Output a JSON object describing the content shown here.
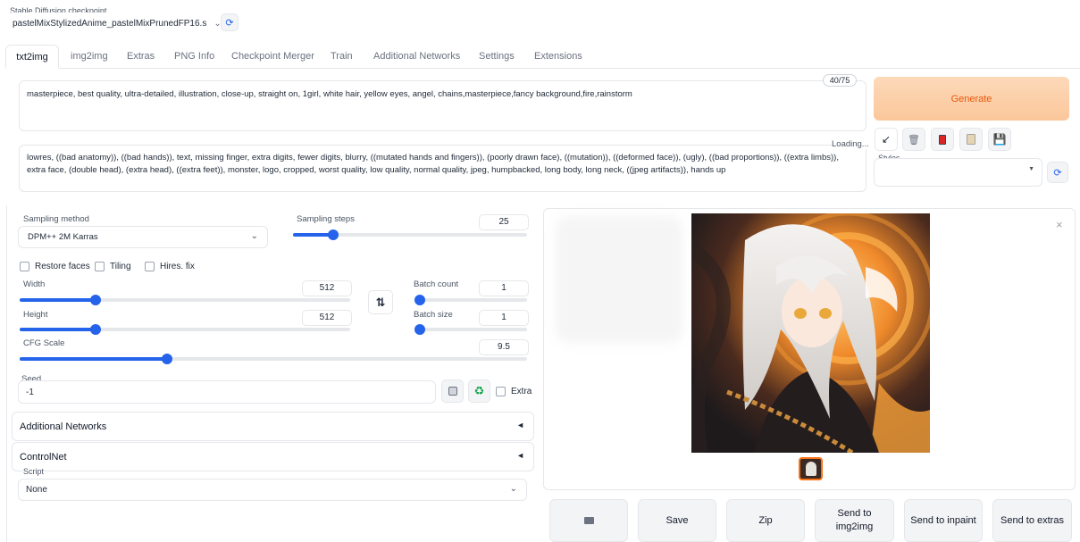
{
  "checkpoint": {
    "label": "Stable Diffusion checkpoint",
    "value": "pastelMixStylizedAnime_pastelMixPrunedFP16.s"
  },
  "tabs": [
    "txt2img",
    "img2img",
    "Extras",
    "PNG Info",
    "Checkpoint Merger",
    "Train",
    "Additional Networks",
    "Settings",
    "Extensions"
  ],
  "prompt": {
    "text": "masterpiece, best quality, ultra-detailed, illustration, close-up, straight on, 1girl, white hair, yellow eyes, angel, chains,masterpiece,fancy background,fire,rainstorm",
    "token_count": "40/75"
  },
  "negative_prompt": {
    "text": "lowres, ((bad anatomy)), ((bad hands)), text, missing finger, extra digits, fewer digits, blurry, ((mutated hands and fingers)), (poorly drawn face), ((mutation)), ((deformed face)), (ugly), ((bad proportions)), ((extra limbs)), extra face, (double head), (extra head), ((extra feet)), monster, logo, cropped, worst quality, low quality, normal quality, jpeg, humpbacked, long body, long neck, ((jpeg artifacts)), hands up",
    "status": "Loading..."
  },
  "generate_label": "Generate",
  "styles_label": "Styles",
  "sampling": {
    "method_label": "Sampling method",
    "method_value": "DPM++ 2M Karras",
    "steps_label": "Sampling steps",
    "steps_value": "25",
    "steps_fraction": 0.17
  },
  "options": {
    "restore_faces": "Restore faces",
    "tiling": "Tiling",
    "hires_fix": "Hires. fix"
  },
  "width": {
    "label": "Width",
    "value": "512",
    "fraction": 0.23
  },
  "height": {
    "label": "Height",
    "value": "512",
    "fraction": 0.23
  },
  "swap_icon": "⇅",
  "batch_count": {
    "label": "Batch count",
    "value": "1",
    "fraction": 0.0
  },
  "batch_size": {
    "label": "Batch size",
    "value": "1",
    "fraction": 0.0
  },
  "cfg": {
    "label": "CFG Scale",
    "value": "9.5",
    "fraction": 0.29
  },
  "seed": {
    "label": "Seed",
    "value": "-1",
    "extra_label": "Extra"
  },
  "additional_networks_label": "Additional Networks",
  "controlnet_label": "ControlNet",
  "collapse_glyph": "◄",
  "script": {
    "label": "Script",
    "value": "None"
  },
  "output_buttons": [
    "Save",
    "Zip",
    "Send to img2img",
    "Send to inpaint",
    "Send to extras"
  ],
  "icons": {
    "refresh": "refresh-icon",
    "paste": "arrow-icon",
    "trash": "trash-icon",
    "card": "card-icon",
    "clipboard": "clipboard-icon",
    "save": "floppy-icon",
    "dice": "dice-icon",
    "recycle": "recycle-icon",
    "folder": "folder-icon",
    "close": "close-icon"
  },
  "colors": {
    "accent": "#2563eb",
    "generate_bg": "#fcd3b0",
    "generate_text": "#ea580c"
  }
}
